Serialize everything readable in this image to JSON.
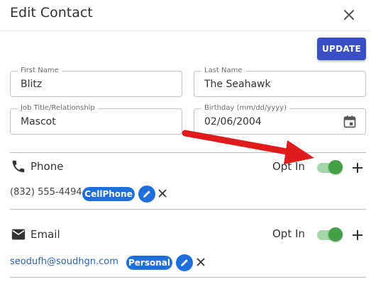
{
  "dialog": {
    "title": "Edit Contact",
    "close_icon": "close-icon",
    "update_label": "UPDATE"
  },
  "fields": {
    "first_name": {
      "label": "First Name",
      "value": "Blitz"
    },
    "last_name": {
      "label": "Last Name",
      "value": "The Seahawk"
    },
    "job_title": {
      "label": "Job Title/Relationship",
      "value": "Mascot"
    },
    "birthday": {
      "label": "Birthday (mm/dd/yyyy)",
      "value": "02/06/2004",
      "icon": "calendar-icon"
    }
  },
  "phone": {
    "label": "Phone",
    "icon": "phone-icon",
    "opt_label": "Opt In",
    "opt_in": true,
    "entries": [
      {
        "value": "(832) 555-4494",
        "type": "CellPhone"
      }
    ]
  },
  "email": {
    "label": "Email",
    "icon": "mail-icon",
    "opt_label": "Opt In",
    "opt_in": true,
    "entries": [
      {
        "value": "seodufh@soudhgn.com",
        "type": "Personal"
      }
    ]
  },
  "colors": {
    "primary": "#3b4fc4",
    "chip": "#1e6fd9",
    "toggle_on": "#43a047",
    "toggle_track": "#a5d6a7",
    "annotation_arrow": "#e01b1b"
  }
}
